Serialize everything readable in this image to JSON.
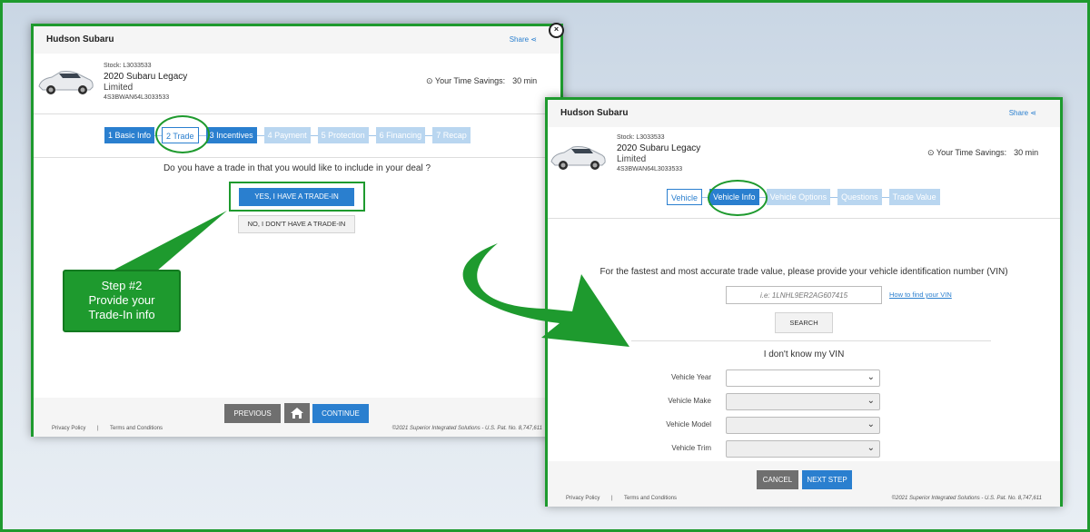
{
  "left_panel": {
    "dealer": "Hudson Subaru",
    "share": "Share",
    "close": "×",
    "stock": "Stock: L3033533",
    "model": "2020 Subaru Legacy",
    "trim": "Limited",
    "vin": "4S3BWAN64L3033533",
    "savings_label": "Your Time Savings:",
    "savings_value": "30 min",
    "steps": [
      {
        "label": "1 Basic Info",
        "state": "done"
      },
      {
        "label": "2 Trade",
        "state": "current"
      },
      {
        "label": "3 Incentives",
        "state": "done"
      },
      {
        "label": "4 Payment",
        "state": "todo"
      },
      {
        "label": "5 Protection",
        "state": "todo"
      },
      {
        "label": "6 Financing",
        "state": "todo"
      },
      {
        "label": "7 Recap",
        "state": "todo"
      }
    ],
    "question": "Do you have a trade in that you would like to include in your deal ?",
    "yes_button": "YES, I HAVE A TRADE-IN",
    "no_button": "NO, I DON'T HAVE A TRADE-IN",
    "previous": "PREVIOUS",
    "continue": "CONTINUE",
    "privacy": "Privacy Policy",
    "separator": "|",
    "terms": "Terms and Conditions",
    "copyright": "©2021 Superior Integrated Solutions - U.S. Pat. No. 8,747,611"
  },
  "callout": {
    "line1": "Step #2",
    "line2": "Provide your",
    "line3": "Trade-In info"
  },
  "right_panel": {
    "dealer": "Hudson Subaru",
    "share": "Share",
    "stock": "Stock: L3033533",
    "model": "2020 Subaru Legacy",
    "trim": "Limited",
    "vin": "4S3BWAN64L3033533",
    "savings_label": "Your Time Savings:",
    "savings_value": "30 min",
    "substeps": [
      {
        "label": "Vehicle",
        "state": "current"
      },
      {
        "label": "Vehicle Info",
        "state": "done"
      },
      {
        "label": "Vehicle Options",
        "state": "todo"
      },
      {
        "label": "Questions",
        "state": "todo"
      },
      {
        "label": "Trade Value",
        "state": "todo"
      }
    ],
    "vin_prompt": "For the fastest and most accurate trade value, please provide your vehicle identification number (VIN)",
    "vin_placeholder": "i.e: 1LNHL9ER2AG607415",
    "how_to_find": "How to find your VIN",
    "search": "SEARCH",
    "dont_know": "I don't know my VIN",
    "fields": [
      {
        "label": "Vehicle Year",
        "disabled": false
      },
      {
        "label": "Vehicle Make",
        "disabled": true
      },
      {
        "label": "Vehicle Model",
        "disabled": true
      },
      {
        "label": "Vehicle Trim",
        "disabled": true
      }
    ],
    "cancel": "CANCEL",
    "next_step": "NEXT STEP",
    "privacy": "Privacy Policy",
    "separator": "|",
    "terms": "Terms and Conditions",
    "copyright": "©2021 Superior Integrated Solutions - U.S. Pat. No. 8,747,611"
  },
  "colors": {
    "accent_green": "#1e9a2e",
    "primary_blue": "#2a7fcf",
    "pending_blue": "#b9d6f0"
  }
}
